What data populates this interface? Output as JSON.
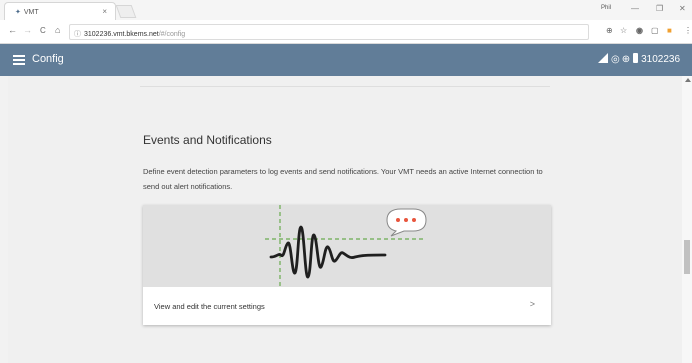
{
  "browser": {
    "tab_title": "VMT",
    "tab_close": "×",
    "user": "Phil",
    "window_controls": {
      "minimize": "—",
      "restore": "❐",
      "close": "✕"
    },
    "nav": {
      "back": "←",
      "forward": "→",
      "reload": "C",
      "home": "⌂"
    },
    "url_host": "3102236.vmt.bkems.net",
    "url_path": "/#/config",
    "toolbar_icons": [
      "zoom-icon",
      "star-icon",
      "extension-icon",
      "cast-icon",
      "extension-orange-icon",
      "menu-icon"
    ]
  },
  "appbar": {
    "title": "Config",
    "device_id": "3102236",
    "color": "#617d98"
  },
  "section": {
    "title": "Events and Notifications",
    "description": "Define event detection parameters to log events and send notifications. Your VMT needs an active Internet connection to send out alert notifications.",
    "card_label": "View and edit the current settings",
    "chevron": ">"
  },
  "illustration": {
    "icon": "seismic-waveform-icon",
    "bubble_dots": "•••",
    "accent": "#e8553d"
  }
}
